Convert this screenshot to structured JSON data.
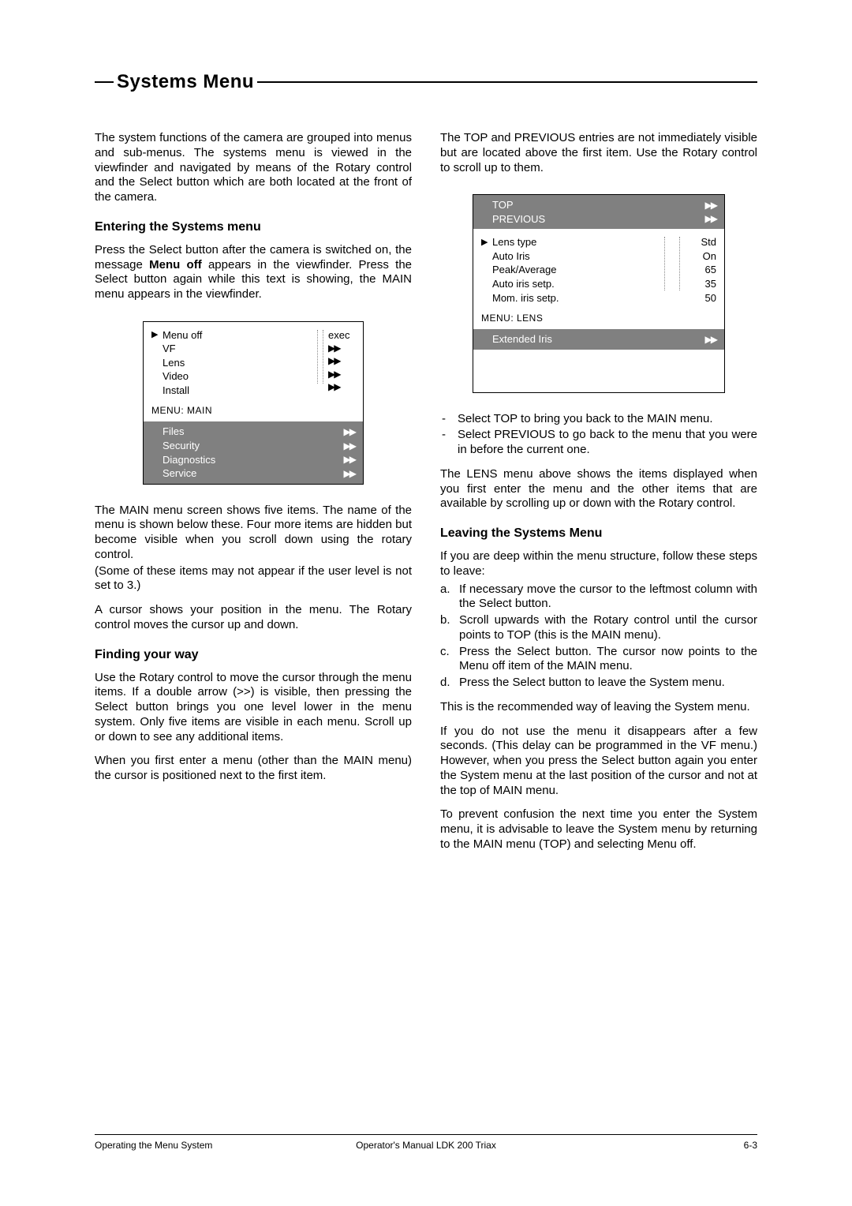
{
  "section_title": "Systems  Menu",
  "left": {
    "p1": "The system functions of the camera are grouped into menus and sub-menus. The systems menu is viewed in the viewfinder and navigated by means of the Rotary control and the Select button which are both located at the front of the camera.",
    "h1": "Entering the Systems menu",
    "p2a": "Press the Select button after the camera is switched on, the message ",
    "p2b": "Menu off",
    "p2c": " appears in the viewfinder. Press the Select button again while this text is showing, the MAIN menu appears in the viewfinder.",
    "main_menu": {
      "items": [
        "Menu off",
        "VF",
        "Lens",
        "Video",
        "Install"
      ],
      "exec": "exec",
      "label": "MENU:  MAIN",
      "grey_items": [
        "Files",
        "Security",
        "Diagnostics",
        "Service"
      ]
    },
    "p3": "The MAIN menu screen shows five items. The name of the menu is shown below these. Four more items are hidden but become visible when you scroll down using the rotary control.",
    "p3note": "(Some of these items may not appear if the user level is not set to 3.)",
    "p4": "A cursor shows your position in the menu. The Rotary control moves the cursor up and down.",
    "h2": "Finding your way",
    "p5": "Use the Rotary control to move the cursor through the menu items. If a double arrow (>>) is visible, then pressing the Select button brings you one level lower in the menu system. Only five items are visible in each menu. Scroll up or down to see any additional items.",
    "p6": "When you first enter a menu (other than the MAIN menu) the cursor is positioned next to the first item."
  },
  "right": {
    "p1": "The TOP and PREVIOUS entries are not immediately visible but are located above the first item. Use the Rotary control to scroll up to them.",
    "lens_menu": {
      "grey_top": [
        "TOP",
        "PREVIOUS"
      ],
      "items": [
        {
          "label": "Lens type",
          "value": "Std"
        },
        {
          "label": "Auto Iris",
          "value": "On"
        },
        {
          "label": "Peak/Average",
          "value": "65"
        },
        {
          "label": "Auto iris setp.",
          "value": "35"
        },
        {
          "label": "Mom. iris setp.",
          "value": "50"
        }
      ],
      "label": "MENU:  LENS",
      "grey_bottom": "Extended Iris"
    },
    "bullets": [
      "Select TOP to bring you back to the MAIN menu.",
      "Select PREVIOUS to go back to the menu that you were in before the current one."
    ],
    "p2": "The LENS menu above shows the items displayed when you first enter the menu and the other items that are available by scrolling up or down with the Rotary control.",
    "h1": "Leaving the Systems Menu",
    "p3": "If you are deep within the menu structure, follow these steps to leave:",
    "steps": [
      "If necessary move the cursor to the leftmost column with the Select button.",
      "Scroll upwards with the Rotary control until the cursor points to TOP (this is the MAIN menu).",
      "Press the Select button. The cursor now points to the Menu off item of the MAIN menu.",
      "Press the Select button to leave the System menu."
    ],
    "p4": "This is the recommended way of leaving the System menu.",
    "p5": "If you do not use the menu it disappears after a few seconds. (This delay can be programmed in the VF menu.) However, when you press the Select button again you enter the System menu at the last position of the cursor and not at the top of MAIN menu.",
    "p6": "To prevent confusion the next time you enter the System menu, it is advisable to leave the System menu by returning to the MAIN menu (TOP) and selecting Menu off."
  },
  "footer": {
    "left": "Operating the Menu System",
    "center": "Operator's Manual LDK 200 Triax",
    "right": "6-3"
  }
}
